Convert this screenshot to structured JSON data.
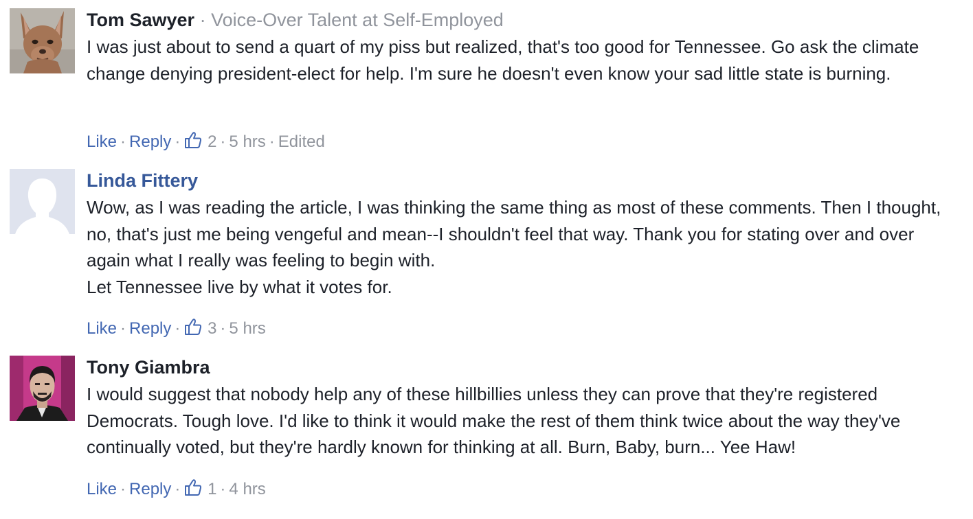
{
  "comments": [
    {
      "author": "Tom Sawyer",
      "subtitle": "Voice-Over Talent at Self-Employed",
      "avatar_icon": "dog-avatar",
      "text": [
        "I was just about to send a quart of my piss but realized, that's too good for Tennessee. Go ask the climate change denying president-elect for help. I'm sure he doesn't even know your sad little state is burning."
      ],
      "actions": {
        "like": "Like",
        "reply": "Reply",
        "like_count": "2",
        "time": "5 hrs",
        "edited": "Edited"
      }
    },
    {
      "author": "Linda Fittery",
      "avatar_icon": "default-profile-avatar",
      "text": [
        "Wow, as I was reading the article, I was thinking the same thing as most of these comments. Then I thought, no, that's just me being vengeful and mean--I shouldn't feel that way. Thank you for stating over and over again what I really was feeling to begin with.",
        "Let Tennessee live by what it votes for."
      ],
      "actions": {
        "like": "Like",
        "reply": "Reply",
        "like_count": "3",
        "time": "5 hrs"
      }
    },
    {
      "author": "Tony Giambra",
      "avatar_icon": "man-portrait-avatar",
      "text": [
        "I would suggest that nobody help any of these hillbillies unless they can prove that they're registered Democrats. Tough love. I'd like to think it would make the rest of them think twice about the way they've continually voted, but they're hardly known for thinking at all. Burn, Baby, burn... Yee Haw!"
      ],
      "actions": {
        "like": "Like",
        "reply": "Reply",
        "like_count": "1",
        "time": "4 hrs"
      }
    }
  ],
  "colors": {
    "link": "#4267b2",
    "author_link": "#365899",
    "meta_gray": "#90949c",
    "text": "#1d2129"
  }
}
